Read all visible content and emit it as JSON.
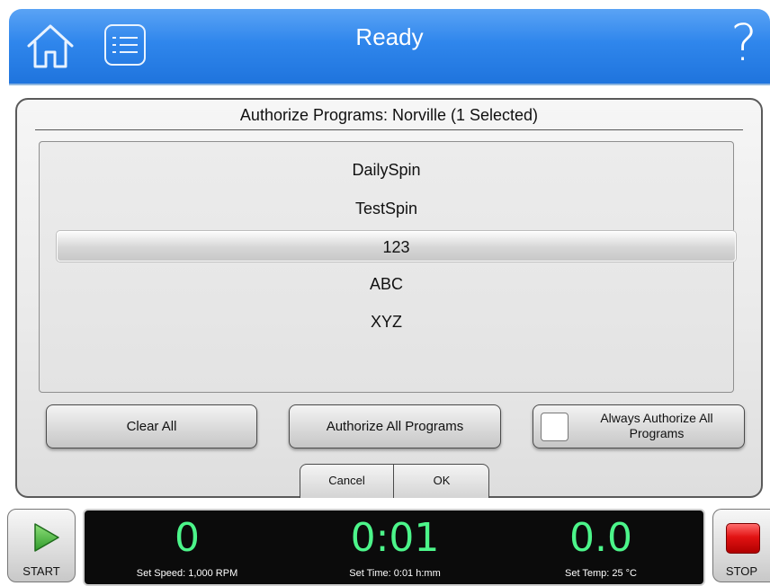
{
  "header": {
    "title": "Ready",
    "home_icon": "home-icon",
    "menu_icon": "list-menu-icon",
    "help_icon": "help-icon",
    "help_glyph": "?",
    "colors": {
      "header_blue": "#2f86ec",
      "text": "#ffffff"
    }
  },
  "dialog": {
    "title": "Authorize Programs: Norville (1 Selected)",
    "programs": [
      {
        "label": "DailySpin",
        "selected": false
      },
      {
        "label": "TestSpin",
        "selected": false
      },
      {
        "label": "123",
        "selected": true
      },
      {
        "label": "ABC",
        "selected": false
      },
      {
        "label": "XYZ",
        "selected": false
      }
    ],
    "buttons": {
      "clear_all": "Clear All",
      "authorize_all": "Authorize All Programs",
      "always_authorize_line1": "Always Authorize All",
      "always_authorize_line2": "Programs",
      "always_authorize_checked": false,
      "cancel": "Cancel",
      "ok": "OK"
    }
  },
  "controls": {
    "start_label": "START",
    "stop_label": "STOP",
    "start_icon": "play-icon",
    "stop_icon": "stop-icon"
  },
  "status": {
    "speed_value": "0",
    "speed_label": "Set Speed: 1,000 RPM",
    "time_value": "0:01",
    "time_label": "Set Time: 0:01 h:mm",
    "temp_value": "0.0",
    "temp_label": "Set Temp: 25 °C",
    "value_color": "#4cf58a"
  }
}
